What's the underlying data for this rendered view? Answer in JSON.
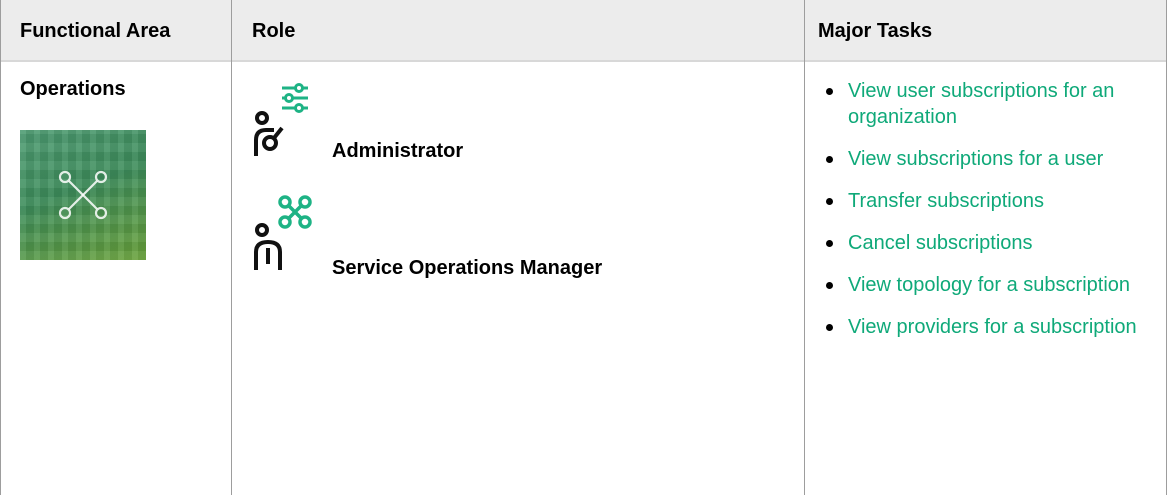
{
  "table": {
    "headers": [
      "Functional Area",
      "Role",
      "Major Tasks"
    ],
    "row": {
      "functional_area": {
        "title": "Operations",
        "tile_icon": "topology-network-icon"
      },
      "roles": [
        {
          "label": "Administrator",
          "icon": "administrator-role-icon"
        },
        {
          "label": "Service Operations Manager",
          "icon": "operations-manager-role-icon"
        }
      ],
      "tasks": [
        "View user subscriptions for an organization",
        "View subscriptions for a user",
        "Transfer subscriptions",
        "Cancel subscriptions",
        "View topology for a subscription",
        "View providers for a subscription"
      ]
    }
  },
  "colors": {
    "link": "#0fa979",
    "accent_icon": "#1eb385",
    "header_bg": "#ececec",
    "tile": "#4e9c73"
  }
}
